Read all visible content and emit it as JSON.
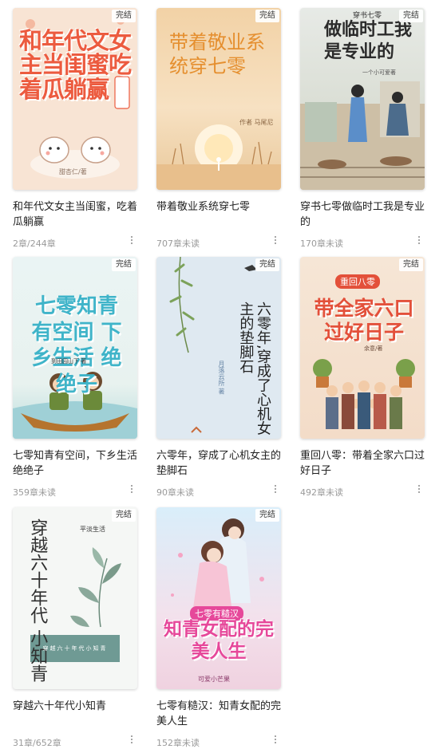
{
  "status_badge": "完结",
  "books": [
    {
      "title": "和年代文女主当闺蜜，吃着瓜躺赢",
      "count": "2章/244章",
      "cover": {
        "title": "和年代文女主当闺蜜吃着瓜躺赢",
        "sub": "甜杏仁/著",
        "accent": "#ec5b3f",
        "art": [
          "cat-bear-mascots"
        ]
      }
    },
    {
      "title": "带着敬业系统穿七零",
      "count": "707章未读",
      "cover": {
        "title": "带着敬业系统穿七零",
        "sub": "作者 马尾尼",
        "accent": "#e58f2f",
        "art": [
          "sunset-sun",
          "reeds"
        ]
      }
    },
    {
      "title": "穿书七零做临时工我是专业的",
      "count": "170章未读",
      "cover": {
        "title": "做临时工我是专业的",
        "tag": "穿书七零",
        "sub": "一个小可爱著",
        "accent": "#2b2b2b",
        "art": [
          "young-man-crouching",
          "woman-standing",
          "steps"
        ]
      }
    },
    {
      "title": "七零知青有空间，下乡生活绝绝子",
      "count": "359章未读",
      "cover": {
        "title": "七零知青有空间 下乡生活 绝绝子",
        "sub": "到田园山下·著",
        "accent": "#3fb4c9",
        "art": [
          "boat",
          "two-kids-in-uniform"
        ]
      }
    },
    {
      "title": "六零年，穿成了心机女主的垫脚石",
      "count": "90章未读",
      "cover": {
        "title": "六零年,穿成了心机女主的垫脚石",
        "sub": "月落云所 著",
        "accent": "#222222",
        "art": [
          "willow-branches",
          "swallows"
        ]
      }
    },
    {
      "title": "重回八零：带着全家六口过好日子",
      "count": "492章未读",
      "cover": {
        "title": "带全家六口 过好日子",
        "tag": "重回八零",
        "sub": "余意/著",
        "accent": "#e3503a",
        "art": [
          "family-group",
          "potted-plants"
        ]
      }
    },
    {
      "title": "穿越六十年代小知青",
      "count": "31章/652章",
      "cover": {
        "title": "穿越六十年代 小知青",
        "sub": "平淡生活",
        "band": "穿越六十年代小知青",
        "accent": "#2f2f2f",
        "art": [
          "ink-leaves"
        ]
      }
    },
    {
      "title": "七零有糙汉：知青女配的完美人生",
      "count": "152章未读",
      "cover": {
        "title": "知青女配的完美人生",
        "tag": "七零有糙汉",
        "sub": "可爱小芒果",
        "accent": "#e6489a",
        "art": [
          "couple-embrace",
          "petals"
        ]
      }
    }
  ]
}
